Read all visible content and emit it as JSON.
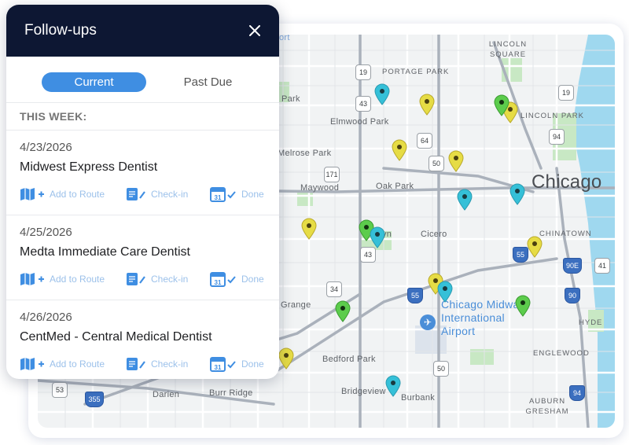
{
  "panel": {
    "title": "Follow-ups",
    "close_icon": "close-icon",
    "tabs": [
      {
        "label": "Current",
        "active": true
      },
      {
        "label": "Past Due",
        "active": false
      }
    ],
    "section_heading": "THIS WEEK:",
    "items": [
      {
        "date": "4/23/2026",
        "name": "Midwest Express Dentist"
      },
      {
        "date": "4/25/2026",
        "name": "Medta Immediate Care Dentist"
      },
      {
        "date": "4/26/2026",
        "name": "CentMed - Central Medical Dentist"
      }
    ],
    "actions": {
      "add_route": "Add to Route",
      "check_in": "Check-in",
      "done": "Done"
    },
    "colors": {
      "header": "#0d1733",
      "accent": "#3f8ee2",
      "action": "#9cc1ea"
    }
  },
  "map": {
    "city": "Chicago",
    "airport": "Chicago Midway International Airport",
    "places": {
      "portage_park": "PORTAGE PARK",
      "lincoln_square": "LINCOLN SQUARE",
      "lincoln_park": "LINCOLN PARK",
      "chinatown": "CHINATOWN",
      "hyde": "HYDE",
      "englewood": "ENGLEWOOD",
      "auburn_gresham": "AUBURN GRESHAM",
      "elmwood_park": "Elmwood Park",
      "melrose_park": "Melrose Park",
      "maywood": "Maywood",
      "oak_park": "Oak Park",
      "cicero": "Cicero",
      "bedford_park": "Bedford Park",
      "bridgeview": "Bridgeview",
      "burbank": "Burbank",
      "darien": "Darien",
      "burr_ridge": "Burr Ridge",
      "grange": "Grange",
      "park": "Park",
      "yn": "yn",
      "ort": "ort"
    },
    "shields": [
      "19",
      "43",
      "64",
      "171",
      "50",
      "43",
      "34",
      "55",
      "55",
      "90E",
      "41",
      "90",
      "94",
      "50",
      "53",
      "355",
      "94",
      "19",
      "41"
    ],
    "pin_colors": {
      "teal": "#35c0d8",
      "yellow": "#e6dc45",
      "green": "#5ccc4c"
    }
  }
}
